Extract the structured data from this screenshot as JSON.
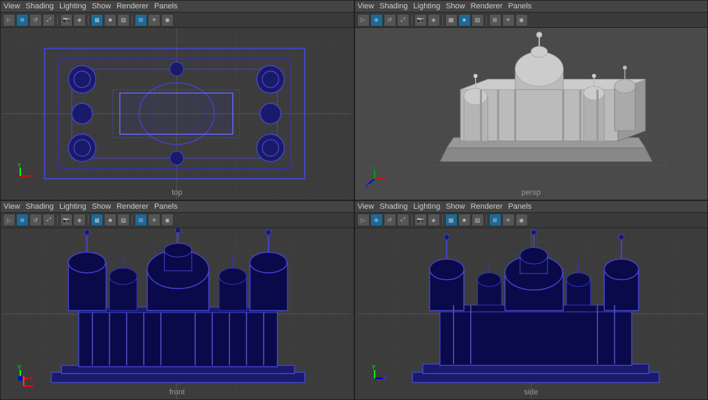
{
  "viewports": [
    {
      "id": "top",
      "label": "top",
      "position": "top-left",
      "menu": [
        "View",
        "Shading",
        "Lighting",
        "Show",
        "Renderer",
        "Panels"
      ]
    },
    {
      "id": "persp",
      "label": "persp",
      "position": "top-right",
      "menu": [
        "View",
        "Shading",
        "Lighting",
        "Show",
        "Renderer",
        "Panels"
      ]
    },
    {
      "id": "front",
      "label": "front",
      "position": "bottom-left",
      "menu": [
        "View",
        "Shading",
        "Lighting",
        "Show",
        "Renderer",
        "Panels"
      ]
    },
    {
      "id": "side",
      "label": "side",
      "position": "bottom-right",
      "menu": [
        "View",
        "Shading",
        "Lighting",
        "Show",
        "Renderer",
        "Panels"
      ]
    }
  ],
  "menu": {
    "view": "View",
    "shading": "Shading",
    "lighting": "Lighting",
    "show": "Show",
    "renderer": "Renderer",
    "panels": "Panels"
  }
}
